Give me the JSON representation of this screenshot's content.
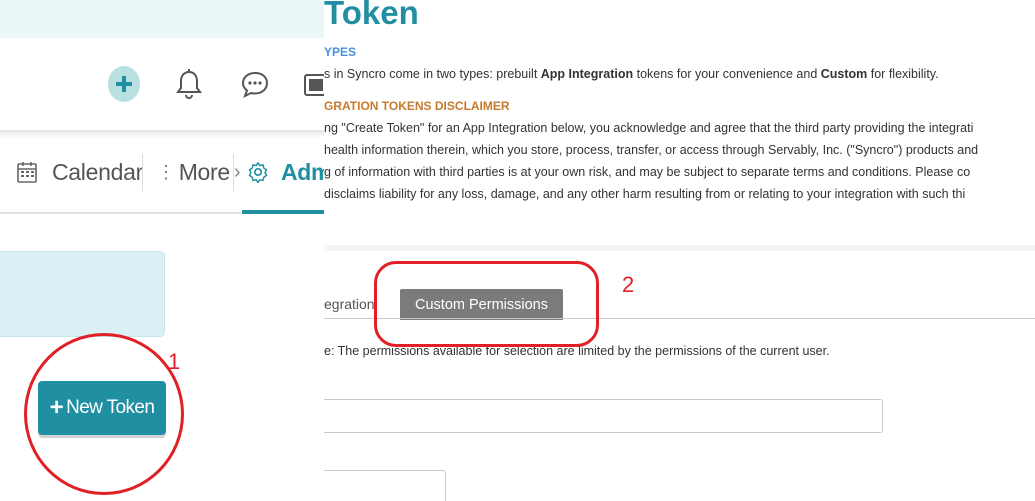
{
  "nav": {
    "calendar": "Calendar",
    "more": "More",
    "admin": "Admi"
  },
  "toolbar_icons": [
    "plus-circle-icon",
    "bell-icon",
    "chat-icon"
  ],
  "buttons": {
    "new_token": "New Token"
  },
  "page": {
    "title": "Token",
    "types_heading": "YPES",
    "types_body": {
      "p1": "s in Syncro come in two types: prebuilt ",
      "b1": "App Integration",
      "p2": " tokens for your convenience and ",
      "b2": "Custom",
      "p3": " for flexibility."
    },
    "disclaimer_heading": "GRATION TOKENS DISCLAIMER",
    "disclaimer_lines": [
      "ng \"Create Token\" for an App Integration below, you acknowledge and agree that the third party providing the integrati",
      " health information therein, which you store, process, transfer, or access through Servably, Inc. (\"Syncro\") products and",
      "g of information with third parties is at your own risk, and may be subject to separate terms and conditions. Please co",
      "disclaims liability for any loss, damage, and any other harm resulting from or relating to your integration with such thi"
    ]
  },
  "tabs": {
    "integration": "egration",
    "custom": "Custom Permissions"
  },
  "note": "e: The permissions available for selection are limited by the permissions of the current user.",
  "annotations": {
    "label_1": "1",
    "label_2": "2"
  },
  "colors": {
    "accent": "#1f8fa1",
    "annotation": "#e01f26",
    "active_tab": "#7b7b7b",
    "types_heading": "#4a90d9",
    "disclaimer_heading": "#c67a2c"
  }
}
